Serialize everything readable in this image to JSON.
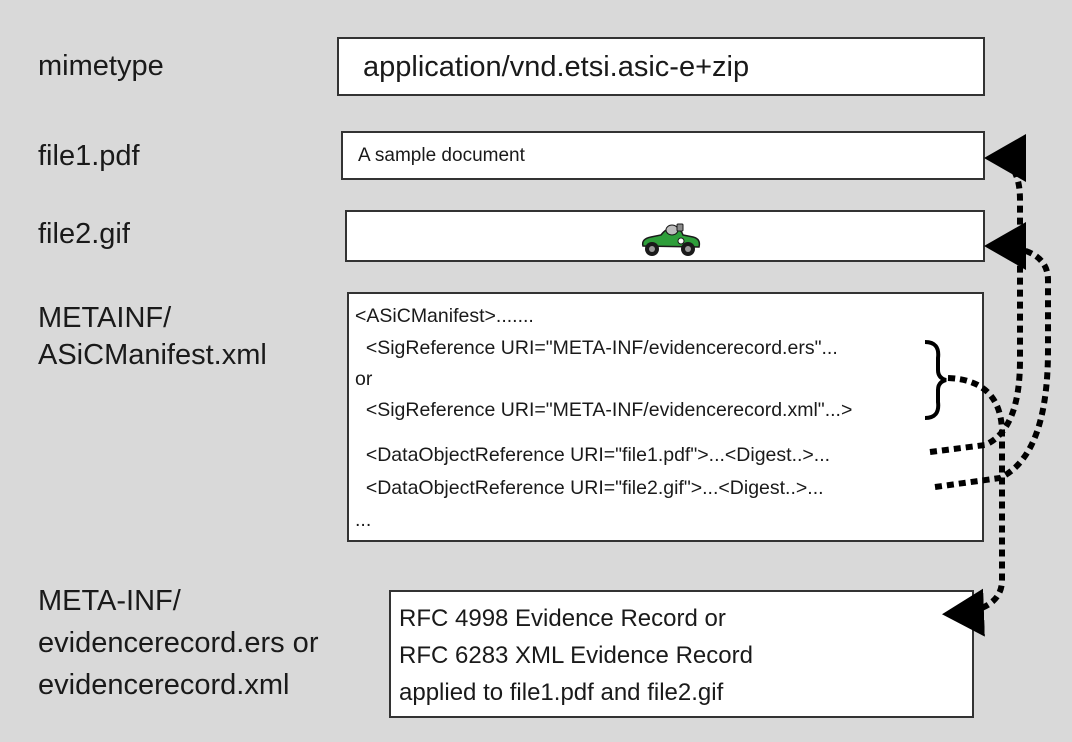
{
  "labels": {
    "mimetype": "mimetype",
    "file1": "file1.pdf",
    "file2": "file2.gif",
    "manifest_line1": "METAINF/",
    "manifest_line2": "ASiCManifest.xml",
    "evidence_line1": "META-INF/",
    "evidence_line2": "evidencerecord.ers or",
    "evidence_line3": "evidencerecord.xml"
  },
  "boxes": {
    "mimetype_value": "application/vnd.etsi.asic-e+zip",
    "file1_content": "A sample document",
    "file2_image_icon": "green-race-car-icon",
    "manifest_lines": [
      "<ASiCManifest>.......",
      "  <SigReference URI=\"META-INF/evidencerecord.ers\"...",
      "or",
      "  <SigReference URI=\"META-INF/evidencerecord.xml\"...>",
      "  <DataObjectReference URI=\"file1.pdf\">...<Digest..>...",
      "  <DataObjectReference URI=\"file2.gif\">...<Digest..>...",
      "..."
    ],
    "evidence_lines": [
      "RFC 4998 Evidence Record or",
      "RFC 6283 XML Evidence Record",
      "applied to file1.pdf and file2.gif"
    ]
  },
  "colors": {
    "background": "#d9d9d9",
    "box_fill": "#ffffff",
    "car_green": "#2e9e3a",
    "arrow": "#000000"
  }
}
